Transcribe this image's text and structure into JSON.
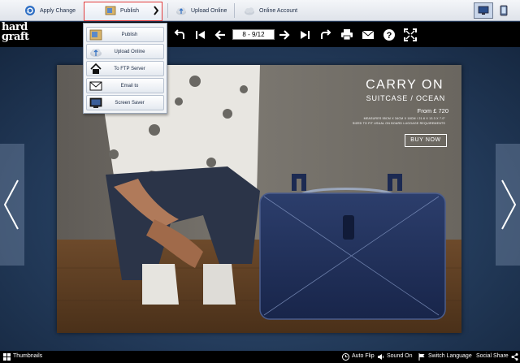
{
  "toolbar": {
    "apply_change": "Apply Change",
    "publish": "Publish",
    "upload_online": "Upload Online",
    "online_account": "Online Account"
  },
  "publish_menu": {
    "items": [
      {
        "label": "Publish",
        "icon": "publish-icon"
      },
      {
        "label": "Upload Online",
        "icon": "upload-cloud-icon"
      },
      {
        "label": "To FTP Server",
        "icon": "house-icon"
      },
      {
        "label": "Email to",
        "icon": "envelope-icon"
      },
      {
        "label": "Screen Saver",
        "icon": "monitor-icon"
      }
    ]
  },
  "logo": {
    "line1": "hard",
    "line2": "graft"
  },
  "viewer": {
    "page_indicator": "8 - 9/12"
  },
  "ad": {
    "title": "CARRY ON",
    "subtitle": "SUITCASE / OCEAN",
    "price": "From £ 720",
    "measures": "MEASURES 55CM X 34CM X 18CM / 21.6 X 13.3 X 7.0\"",
    "sized": "SIZED TO FIT USUAL ON BOARD LUGGAGE REQUIREMENTS",
    "buy": "BUY NOW"
  },
  "status": {
    "thumbnails": "Thumbnails",
    "auto_flip": "Auto Flip",
    "sound_on": "Sound On",
    "switch_language": "Switch Language",
    "social_share": "Social Share"
  },
  "colors": {
    "toolbar_bg": "#e6eaf0",
    "viewer_bar": "#000000",
    "stage": "#2a4466",
    "highlight": "#e23c3c",
    "suitcase": "#1f2f57"
  }
}
